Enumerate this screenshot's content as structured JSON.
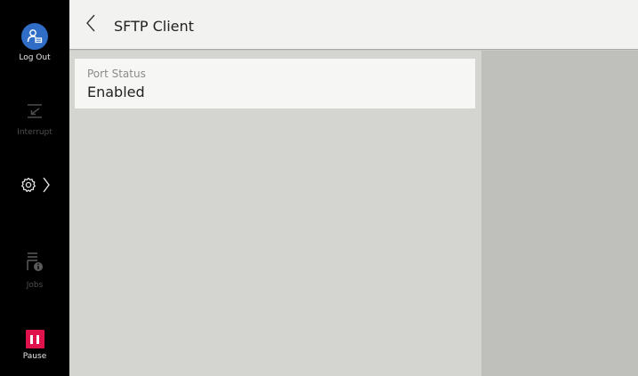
{
  "sidebar": {
    "logout_label": "Log Out",
    "interrupt_label": "Interrupt",
    "jobs_label": "Jobs",
    "pause_label": "Pause"
  },
  "header": {
    "title": "SFTP Client"
  },
  "setting": {
    "label": "Port Status",
    "value": "Enabled"
  },
  "colors": {
    "logout_accent": "#2f6dc7",
    "pause_accent": "#e0124b"
  }
}
